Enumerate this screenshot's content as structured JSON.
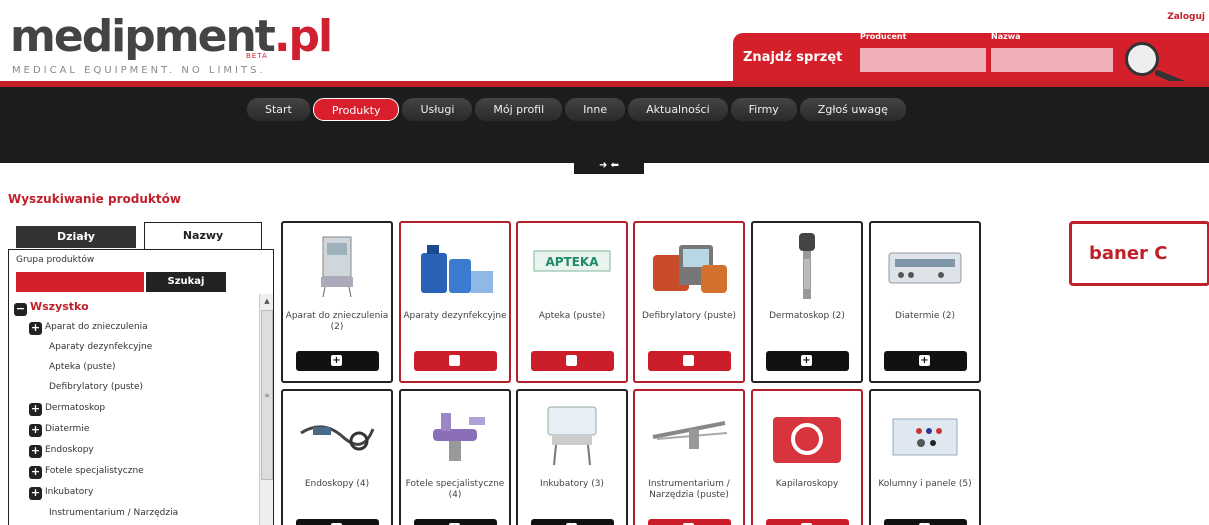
{
  "logo": {
    "name": "medipment.pl",
    "name_main": "medipment",
    "name_tld": ".pl",
    "beta": "BETA",
    "tagline": "MEDICAL EQUIPMENT. NO LIMITS."
  },
  "header": {
    "login": "Zaloguj"
  },
  "search": {
    "title": "Znajdź sprzęt",
    "producer_label": "Producent",
    "name_label": "Nazwa",
    "producer_value": "",
    "name_value": ""
  },
  "nav": {
    "items": [
      "Start",
      "Produkty",
      "Usługi",
      "Mój profil",
      "Inne",
      "Aktualności",
      "Firmy",
      "Zgłoś uwagę"
    ],
    "active": "Produkty",
    "toggle": "➜ ⬅"
  },
  "page": {
    "title": "Wyszukiwanie produktów"
  },
  "sidebar": {
    "tabs": [
      "Działy",
      "Nazwy"
    ],
    "group_label": "Grupa produktów",
    "group_value": "",
    "search_button": "Szukaj",
    "tree": [
      {
        "label": "Wszystko",
        "icon": "minus-icon",
        "level": 0
      },
      {
        "label": "Aparat do znieczulenia",
        "icon": "plus-icon",
        "level": 1
      },
      {
        "label": "Aparaty dezynfekcyjne",
        "icon": "",
        "level": 2
      },
      {
        "label": "Apteka (puste)",
        "icon": "",
        "level": 2
      },
      {
        "label": "Defibrylatory (puste)",
        "icon": "",
        "level": 2
      },
      {
        "label": "Dermatoskop",
        "icon": "plus-icon",
        "level": 1
      },
      {
        "label": "Diatermie",
        "icon": "plus-icon",
        "level": 1
      },
      {
        "label": "Endoskopy",
        "icon": "plus-icon",
        "level": 1
      },
      {
        "label": "Fotele specjalistyczne",
        "icon": "plus-icon",
        "level": 1
      },
      {
        "label": "Inkubatory",
        "icon": "plus-icon",
        "level": 1
      },
      {
        "label": "Instrumentarium / Narzędzia",
        "icon": "",
        "level": 2
      }
    ]
  },
  "products": [
    {
      "label": "Aparat do znieczulenia (2)",
      "red": false,
      "icon": "plus-icon"
    },
    {
      "label": "Aparaty dezynfekcyjne",
      "red": true,
      "icon": "square-icon"
    },
    {
      "label": "Apteka (puste)",
      "red": true,
      "icon": "square-icon",
      "sign": "APTEKA"
    },
    {
      "label": "Defibrylatory (puste)",
      "red": true,
      "icon": "square-icon"
    },
    {
      "label": "Dermatoskop (2)",
      "red": false,
      "icon": "plus-icon"
    },
    {
      "label": "Diatermie (2)",
      "red": false,
      "icon": "plus-icon"
    },
    {
      "label": "Endoskopy (4)",
      "red": false,
      "icon": "plus-icon"
    },
    {
      "label": "Fotele specjalistyczne (4)",
      "red": false,
      "icon": "plus-icon"
    },
    {
      "label": "Inkubatory (3)",
      "red": false,
      "icon": "plus-icon"
    },
    {
      "label": "Instrumentarium / Narzędzia (puste)",
      "red": true,
      "icon": "square-icon"
    },
    {
      "label": "Kapilaroskopy",
      "red": true,
      "icon": "square-icon"
    },
    {
      "label": "Kolumny i panele (5)",
      "red": false,
      "icon": "plus-icon"
    }
  ],
  "banner": {
    "text": "baner C"
  },
  "colors": {
    "brand_red": "#d51f2b",
    "nav_bg": "#1c1c1c"
  }
}
